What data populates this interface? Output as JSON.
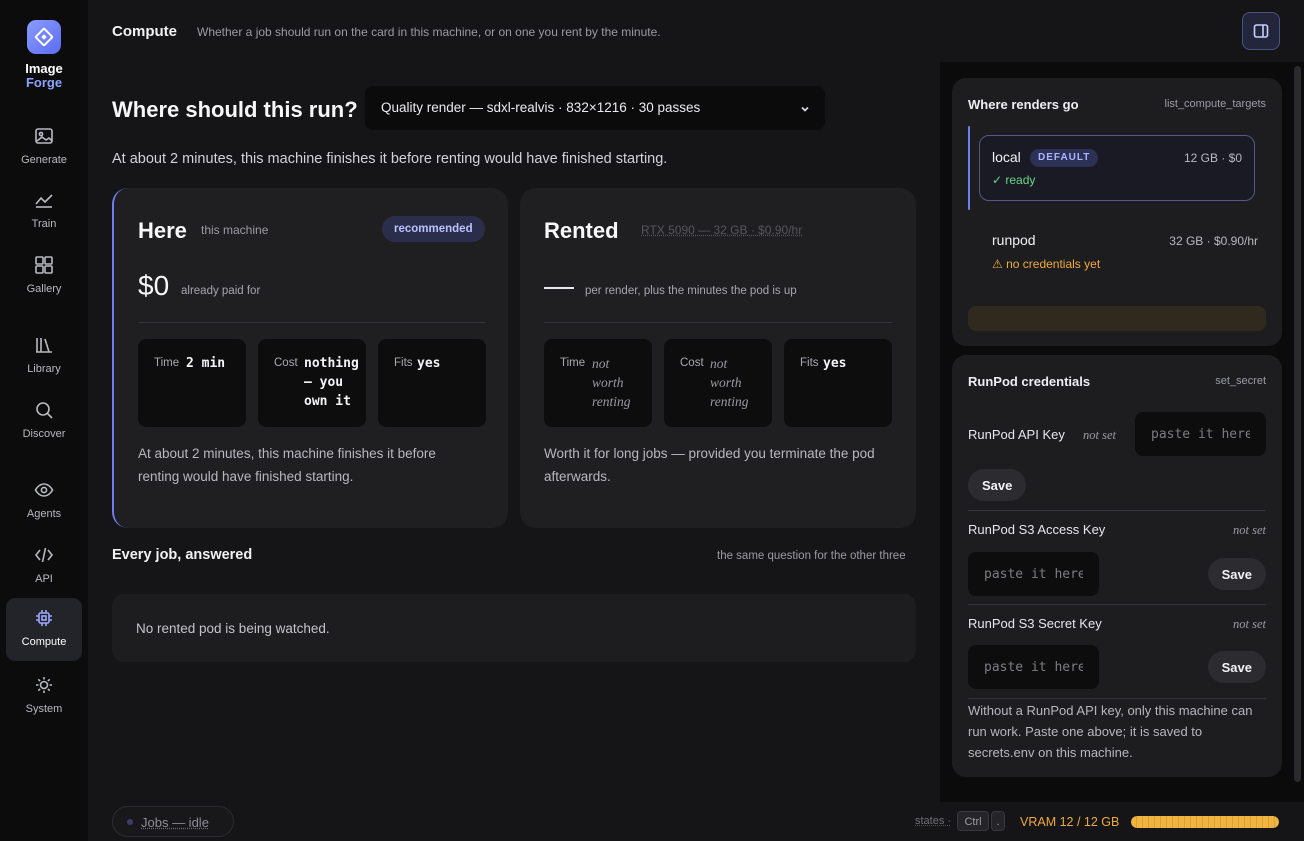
{
  "brand": {
    "line1": "Image",
    "line2": "Forge"
  },
  "nav": [
    {
      "label": "Generate",
      "icon": "image-icon"
    },
    {
      "label": "Train",
      "icon": "chart-line-icon"
    },
    {
      "label": "Gallery",
      "icon": "grid-icon"
    },
    {
      "label": "Library",
      "icon": "library-icon"
    },
    {
      "label": "Discover",
      "icon": "search-icon"
    },
    {
      "label": "Agents",
      "icon": "eye-icon"
    },
    {
      "label": "API",
      "icon": "code-icon"
    },
    {
      "label": "Compute",
      "icon": "chip-icon",
      "active": true
    },
    {
      "label": "System",
      "icon": "sun-icon"
    }
  ],
  "header": {
    "title": "Compute",
    "subtitle": "Whether a job should run on the card in this machine, or on one you rent by the minute."
  },
  "main": {
    "question": "Where should this run?",
    "job_select": "Quality render — sdxl-realvis · 832×1216 · 30 passes",
    "summary": "At about 2 minutes, this machine finishes it before renting would have finished starting."
  },
  "cards": {
    "here": {
      "title": "Here",
      "subtitle": "this machine",
      "badge": "recommended",
      "price": "$0",
      "price_note": "already paid for",
      "stats": {
        "time_label": "Time",
        "time_value": "2 min",
        "cost_label": "Cost",
        "cost_value": "nothing — you own it",
        "fits_label": "Fits",
        "fits_value": "yes"
      },
      "description": "At about 2 minutes, this machine finishes it before renting would have finished starting."
    },
    "rented": {
      "title": "Rented",
      "subtitle": "RTX 5090 — 32 GB · $0.90/hr",
      "price_note": "per render, plus the minutes the pod is up",
      "stats": {
        "time_label": "Time",
        "time_value": "not worth renting",
        "cost_label": "Cost",
        "cost_value": "not worth renting",
        "fits_label": "Fits",
        "fits_value": "yes"
      },
      "description": "Worth it for long jobs — provided you terminate the pod afterwards."
    }
  },
  "every_job": {
    "title": "Every job, answered",
    "note": "the same question for the other three",
    "watch_text": "No rented pod is being watched."
  },
  "targets": {
    "title": "Where renders go",
    "tag": "list_compute_targets",
    "local": {
      "name": "local",
      "badge": "DEFAULT",
      "spec": "12 GB · $0",
      "status": "✓ ready"
    },
    "runpod": {
      "name": "runpod",
      "spec": "32 GB · $0.90/hr",
      "status": "⚠ no credentials yet"
    }
  },
  "credentials": {
    "title": "RunPod credentials",
    "tag": "set_secret",
    "api_key": {
      "name": "RunPod API Key",
      "state": "not set",
      "placeholder": "paste it here",
      "save": "Save"
    },
    "s3_access": {
      "name": "RunPod S3 Access Key",
      "state": "not set",
      "placeholder": "paste it here",
      "save": "Save"
    },
    "s3_secret": {
      "name": "RunPod S3 Secret Key",
      "state": "not set",
      "placeholder": "paste it here",
      "save": "Save"
    },
    "help": "Without a RunPod API key, only this machine can run work. Paste one above; it is saved to secrets.env on this machine."
  },
  "footer": {
    "jobs": "Jobs — idle",
    "states_label": "states ·",
    "kbd_ctrl": "Ctrl",
    "kbd_dot": ".",
    "vram_label": "VRAM 12 / 12 GB",
    "vram_used_fraction": 1.0
  },
  "colors": {
    "accent": "#6f7ee8",
    "ok": "#6fd58a",
    "warn": "#f0a93c"
  }
}
